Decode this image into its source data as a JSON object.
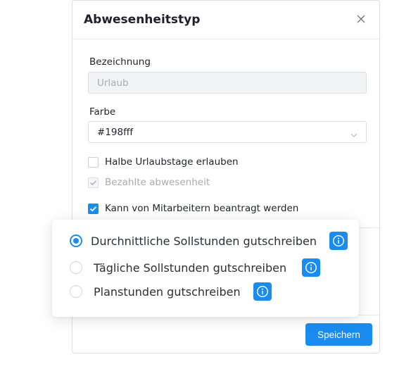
{
  "dialog": {
    "title": "Abwesenheitstyp",
    "name_label": "Bezeichnung",
    "name_value": "Urlaub",
    "color_label": "Farbe",
    "color_value": "#198fff",
    "checkboxes": [
      {
        "label": "Halbe Urlaubstage erlauben",
        "checked": false,
        "disabled": false
      },
      {
        "label": "Bezahlte abwesenheit",
        "checked": true,
        "disabled": true
      },
      {
        "label": "Kann von Mitarbeitern beantragt werden",
        "checked": true,
        "disabled": false
      }
    ],
    "save_label": "Speichern"
  },
  "popover": {
    "options": [
      {
        "label": "Durchnittliche Sollstunden gutschreiben",
        "selected": true
      },
      {
        "label": "Tägliche Sollstunden gutschreiben",
        "selected": false
      },
      {
        "label": "Planstunden gutschreiben",
        "selected": false
      }
    ]
  },
  "colors": {
    "accent": "#1a8cf0",
    "border": "#dcdfe6",
    "disabled_bg": "#f2f3f5"
  },
  "icons": [
    "close-icon",
    "chevron-down-icon",
    "check-icon",
    "info-icon"
  ]
}
